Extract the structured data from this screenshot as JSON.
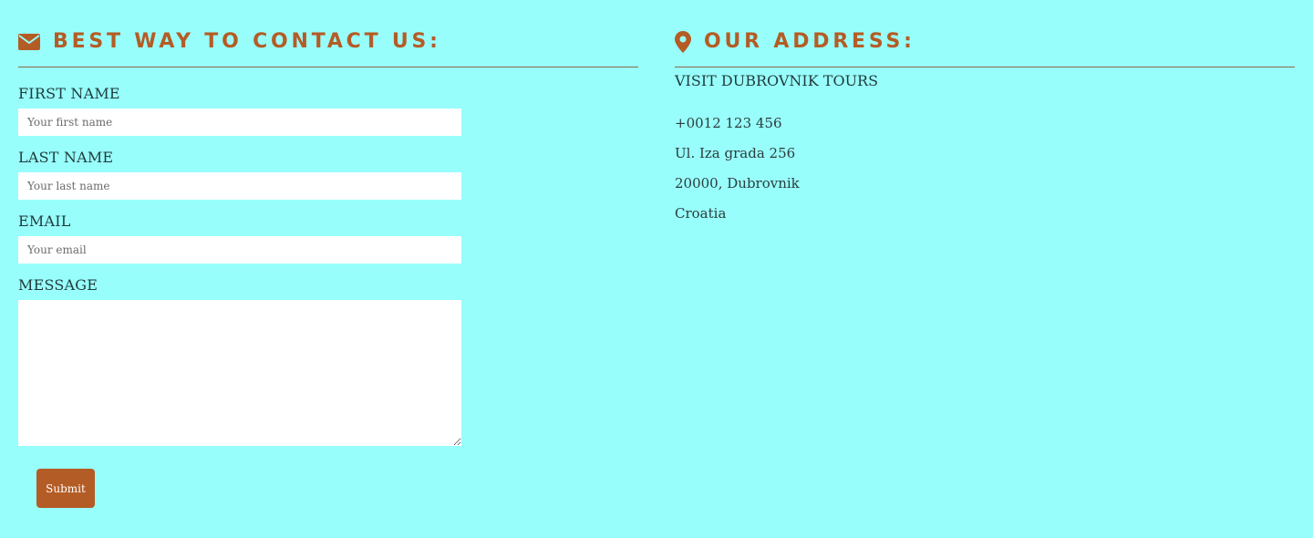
{
  "contact": {
    "heading": "Best way to contact us:",
    "icon": "envelope-icon",
    "fields": {
      "first_name": {
        "label": "First Name",
        "placeholder": "Your first name"
      },
      "last_name": {
        "label": "Last Name",
        "placeholder": "Your last name"
      },
      "email": {
        "label": "Email",
        "placeholder": "Your email"
      },
      "message": {
        "label": "Message"
      }
    },
    "submit_label": "Submit"
  },
  "address": {
    "heading": "Our address:",
    "icon": "map-marker-icon",
    "company": "Visit Dubrovnik Tours",
    "phone": "+0012 123 456",
    "street": "Ul. Iza grada 256",
    "city": "20000, Dubrovnik",
    "country": "Croatia"
  },
  "colors": {
    "background": "#98fefb",
    "accent": "#b45c25",
    "text": "#1f3b3b"
  }
}
